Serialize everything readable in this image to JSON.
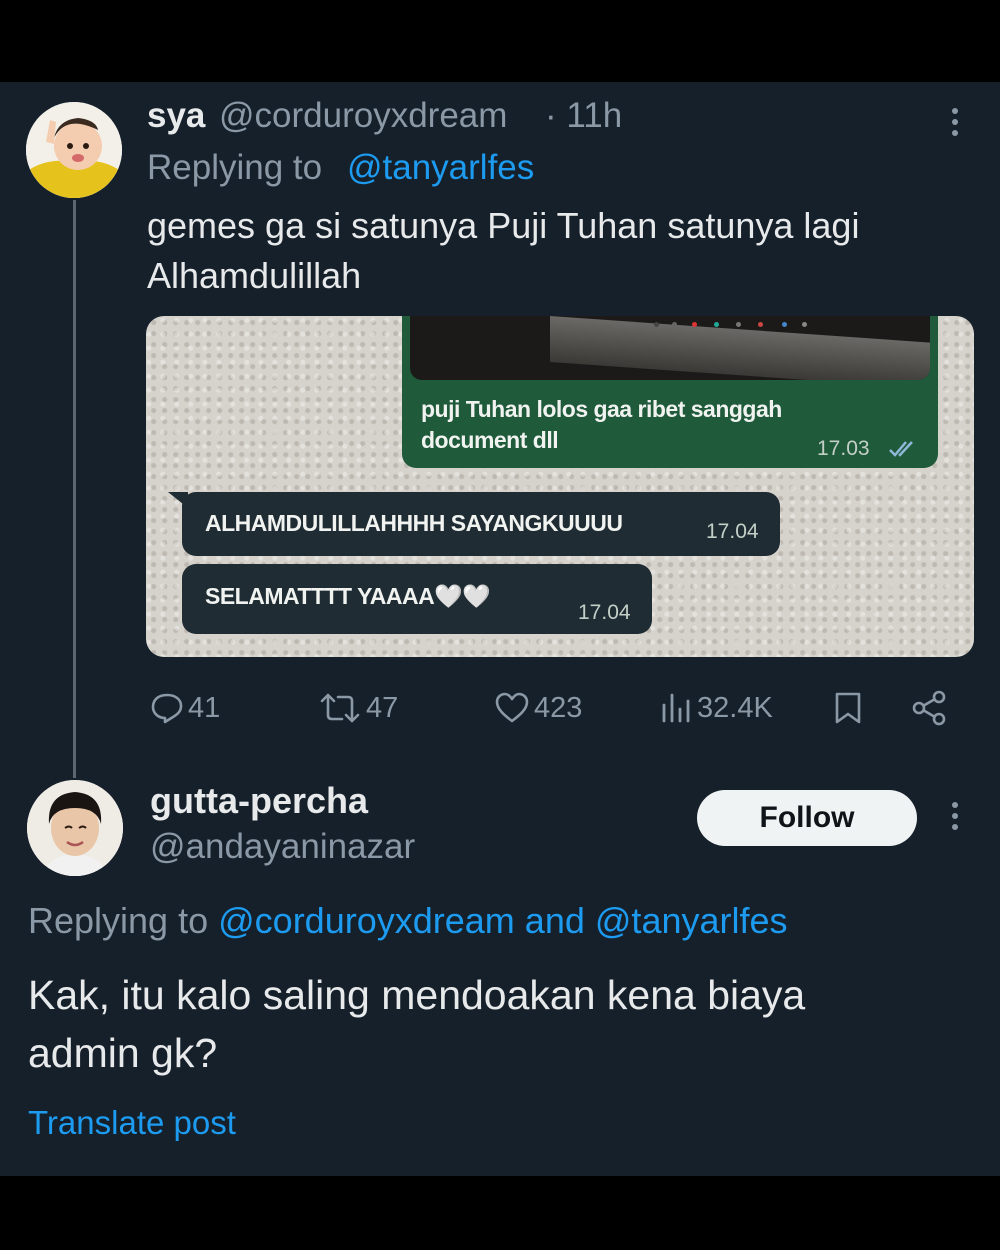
{
  "tweet": {
    "display_name": "sya",
    "handle": "@corduroyxdream",
    "time": "· 11h",
    "replying_label": "Replying to",
    "replying_to": "@tanyarlfes",
    "text_line1": "gemes ga si satunya Puji Tuhan satunya lagi",
    "text_line2": "Alhamdulillah",
    "media": {
      "msg1_line1": "puji Tuhan lolos gaa ribet sanggah",
      "msg1_line2": "document dll",
      "msg1_time": "17.03",
      "msg2": "ALHAMDULILLAHHHH SAYANGKUUUU",
      "msg2_time": "17.04",
      "msg3": "SELAMATTTT YAAAA🤍🤍",
      "msg3_time": "17.04"
    },
    "stats": {
      "replies": "41",
      "reposts": "47",
      "likes": "423",
      "views": "32.4K"
    }
  },
  "reply": {
    "display_name": "gutta-percha",
    "handle": "@andayaninazar",
    "follow_label": "Follow",
    "replying_label": "Replying to",
    "replying_to_1": "@corduroyxdream",
    "and_word": "and",
    "replying_to_2": "@tanyarlfes",
    "text_line1": "Kak, itu kalo saling mendoakan kena biaya",
    "text_line2": "admin gk?",
    "translate_label": "Translate post"
  },
  "icons": [
    "more-icon",
    "reply-icon",
    "repost-icon",
    "like-icon",
    "views-icon",
    "bookmark-icon",
    "share-icon",
    "double-check-icon"
  ],
  "colors": {
    "background": "#15202b",
    "text": "#e7e9ea",
    "muted": "#8b98a5",
    "link": "#1d9bf0",
    "whatsapp_green": "#1f5a3a",
    "whatsapp_dark": "#1f2c33"
  }
}
